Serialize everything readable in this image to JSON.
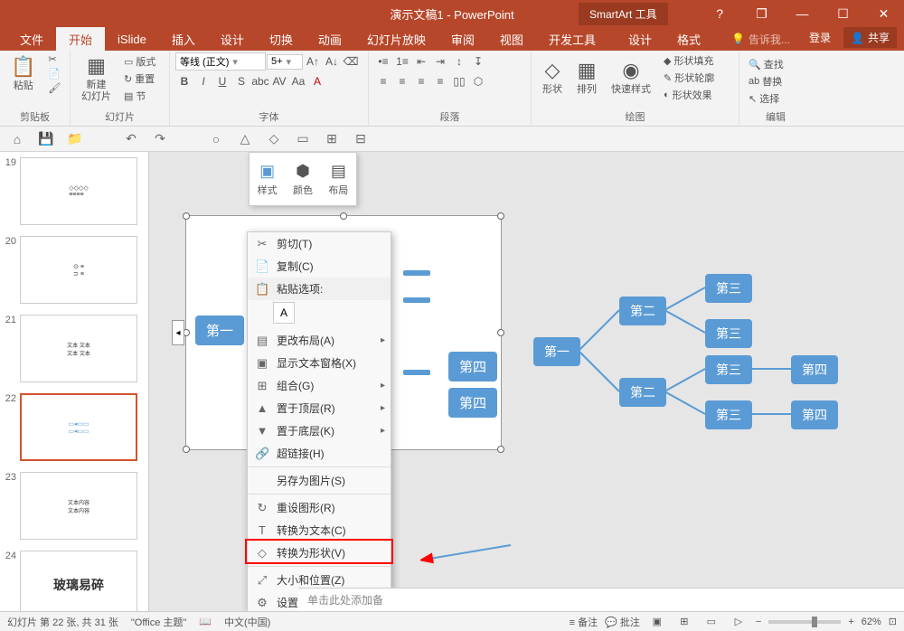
{
  "title": "演示文稿1 - PowerPoint",
  "smartart_tool": "SmartArt 工具",
  "window_controls": {
    "help": "?",
    "restore": "❐",
    "min": "—",
    "max": "☐",
    "close": "✕"
  },
  "tabs": {
    "file": "文件",
    "home": "开始",
    "islide": "iSlide",
    "insert": "插入",
    "design": "设计",
    "transitions": "切换",
    "animations": "动画",
    "slideshow": "幻灯片放映",
    "review": "审阅",
    "view": "视图",
    "developer": "开发工具",
    "sa_design": "设计",
    "sa_format": "格式"
  },
  "tellme": {
    "icon": "💡",
    "text": "告诉我..."
  },
  "account": {
    "login": "登录",
    "share": "共享",
    "share_icon": "👤"
  },
  "ribbon": {
    "clipboard": {
      "paste": "粘贴",
      "cut": "✂",
      "copy": "📄",
      "brush": "🖌",
      "label": "剪贴板"
    },
    "slides": {
      "new": "新建\n幻灯片",
      "layout": "版式",
      "reset": "重置",
      "section": "节",
      "label": "幻灯片"
    },
    "font": {
      "name": "等线 (正文)",
      "size": "5+",
      "label": "字体"
    },
    "paragraph": {
      "label": "段落"
    },
    "drawing": {
      "shapes": "形状",
      "arrange": "排列",
      "quick": "快速样式",
      "fill": "形状填充",
      "outline": "形状轮廓",
      "effects": "形状效果",
      "label": "绘图"
    },
    "editing": {
      "find": "查找",
      "replace": "替换",
      "select": "选择",
      "label": "编辑"
    }
  },
  "qat": {
    "save": "💾",
    "undo": "↶",
    "redo": "↷"
  },
  "style_popup": {
    "style": "样式",
    "color": "颜色",
    "layout": "布局"
  },
  "slides_list": [
    {
      "num": "19"
    },
    {
      "num": "20"
    },
    {
      "num": "21"
    },
    {
      "num": "22",
      "active": true
    },
    {
      "num": "23"
    },
    {
      "num": "24"
    }
  ],
  "nodes": {
    "n1": "第一",
    "n2": "第二",
    "n3": "第三",
    "n4": "第四"
  },
  "context_menu": {
    "cut": "剪切(T)",
    "copy": "复制(C)",
    "paste_opts": "粘贴选项:",
    "change_layout": "更改布局(A)",
    "show_text": "显示文本窗格(X)",
    "group": "组合(G)",
    "bring_front": "置于顶层(R)",
    "send_back": "置于底层(K)",
    "hyperlink": "超链接(H)",
    "save_pic": "另存为图片(S)",
    "reset_shape": "重设图形(R)",
    "convert_text": "转换为文本(C)",
    "convert_shape": "转换为形状(V)",
    "size_pos": "大小和位置(Z)",
    "format_obj": "设置对象格式(O)..."
  },
  "notes": "单击此处添加备",
  "status": {
    "slide_info": "幻灯片 第 22 张, 共 31 张",
    "theme": "\"Office 主题\"",
    "lang": "中文(中国)",
    "notes_btn": "备注",
    "comments_btn": "批注",
    "zoom": "62%"
  },
  "thumb24": {
    "l1": "玻璃",
    "l2": "易碎"
  }
}
